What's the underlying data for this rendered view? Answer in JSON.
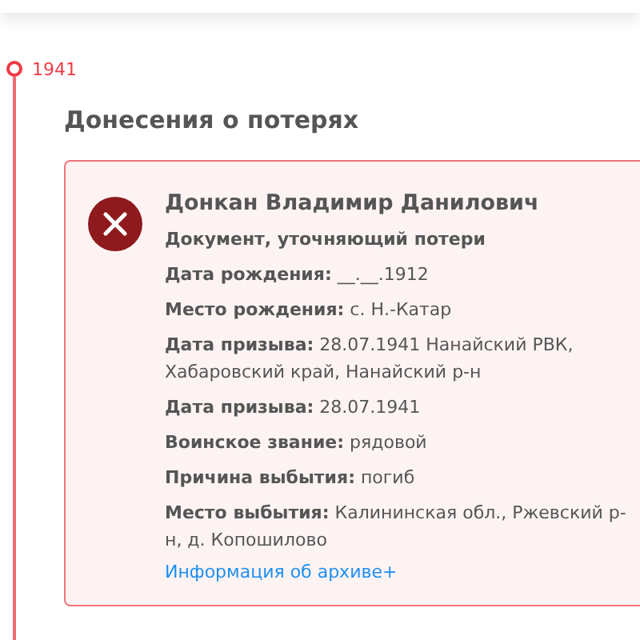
{
  "timeline": {
    "year": "1941"
  },
  "section": {
    "title": "Донесения о потерях"
  },
  "card": {
    "name": "Донкан Владимир Данилович",
    "rows": [
      {
        "kind": "note",
        "text": "Документ, уточняющий потери"
      },
      {
        "kind": "field",
        "label": "Дата рождения:",
        "value": "__.__.1912"
      },
      {
        "kind": "field",
        "label": "Место рождения:",
        "value": "с. Н.-Катар"
      },
      {
        "kind": "field",
        "label": "Дата призыва:",
        "value": "28.07.1941 Нанайский РВК, Хабаровский край, Нанайский р-н"
      },
      {
        "kind": "field",
        "label": "Дата призыва:",
        "value": "28.07.1941"
      },
      {
        "kind": "field",
        "label": "Воинское звание:",
        "value": "рядовой"
      },
      {
        "kind": "field",
        "label": "Причина выбытия:",
        "value": "погиб"
      },
      {
        "kind": "field",
        "label": "Место выбытия:",
        "value": "Калининская обл., Ржевский р-н, д. Копошилово"
      }
    ],
    "link": "Информация об архиве+"
  }
}
